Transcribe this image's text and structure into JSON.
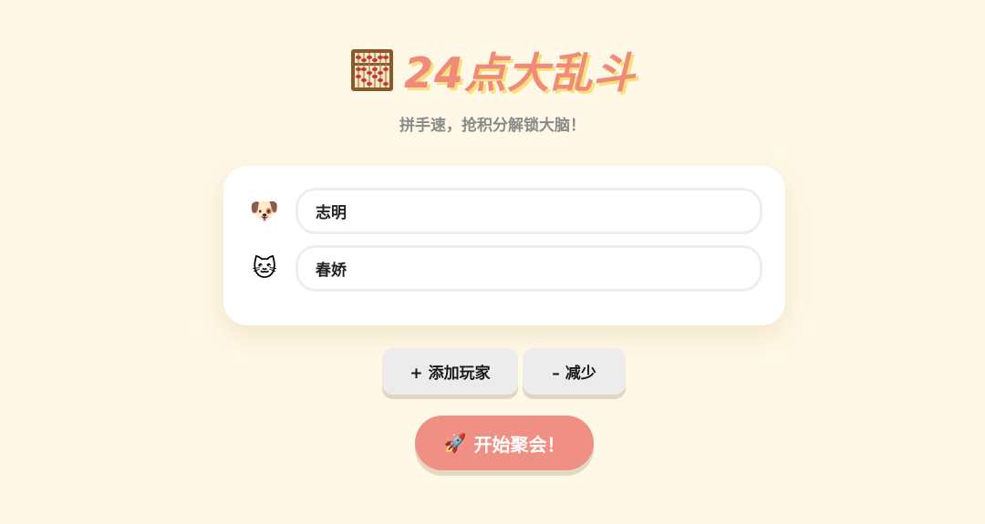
{
  "header": {
    "icon": "abacus-icon",
    "title": "24点大乱斗",
    "subtitle": "拼手速，抢积分解锁大脑！"
  },
  "players": [
    {
      "avatar_icon": "dog-face-icon",
      "avatar_glyph": "🐶",
      "name": "志明"
    },
    {
      "avatar_icon": "cat-face-icon",
      "avatar_glyph": "🐱",
      "name": "春娇"
    }
  ],
  "controls": {
    "add_label": "+ 添加玩家",
    "remove_label": "– 减少",
    "start_icon": "rocket-icon",
    "start_glyph": "🚀",
    "start_label": "开始聚会！"
  },
  "colors": {
    "background": "#fff8e6",
    "title": "#f08a7a",
    "title_shadow": "#fbe07a",
    "start_button": "#f08f84",
    "secondary_button": "#ececec"
  }
}
